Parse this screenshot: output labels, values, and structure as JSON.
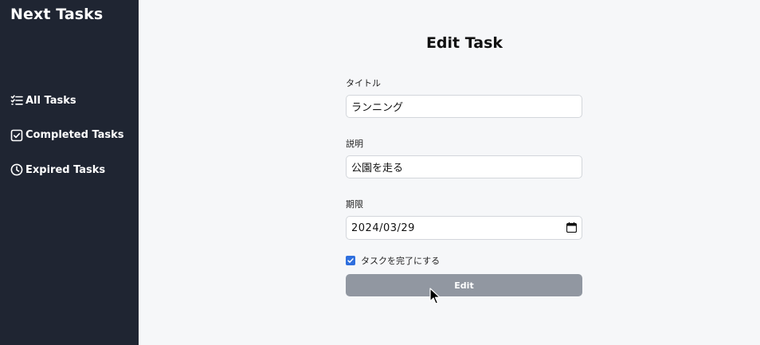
{
  "sidebar": {
    "brand": "Next Tasks",
    "items": [
      {
        "label": "All Tasks",
        "icon": "list-check-icon"
      },
      {
        "label": "Completed Tasks",
        "icon": "checkbox-icon"
      },
      {
        "label": "Expired Tasks",
        "icon": "clock-icon"
      }
    ]
  },
  "main": {
    "title": "Edit Task",
    "form": {
      "title_label": "タイトル",
      "title_value": "ランニング",
      "description_label": "説明",
      "description_value": "公園を走る",
      "deadline_label": "期限",
      "deadline_value": "2024/03/29",
      "complete_label": "タスクを完了にする",
      "complete_checked": true,
      "submit_label": "Edit"
    }
  },
  "colors": {
    "sidebar_bg": "#1f2532",
    "main_bg": "#f6f7f9",
    "checkbox": "#2f6fde",
    "button_bg": "#9197a1"
  }
}
